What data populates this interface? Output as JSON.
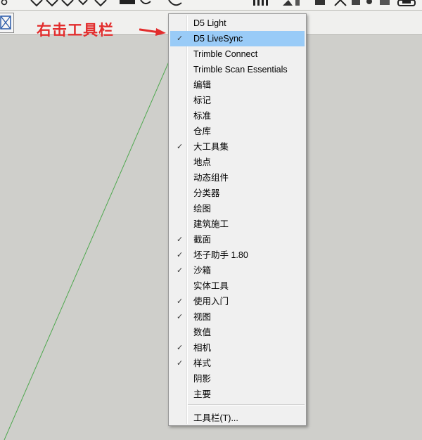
{
  "annotation": {
    "text": "右击工具栏",
    "color": "#e22d2d"
  },
  "context_menu": {
    "items": [
      {
        "label": "D5 Light",
        "checked": false,
        "highlighted": false
      },
      {
        "label": "D5 LiveSync",
        "checked": true,
        "highlighted": true
      },
      {
        "label": "Trimble Connect",
        "checked": false,
        "highlighted": false
      },
      {
        "label": "Trimble Scan Essentials",
        "checked": false,
        "highlighted": false
      },
      {
        "label": "编辑",
        "checked": false,
        "highlighted": false
      },
      {
        "label": "标记",
        "checked": false,
        "highlighted": false
      },
      {
        "label": "标准",
        "checked": false,
        "highlighted": false
      },
      {
        "label": "仓库",
        "checked": false,
        "highlighted": false
      },
      {
        "label": "大工具集",
        "checked": true,
        "highlighted": false
      },
      {
        "label": "地点",
        "checked": false,
        "highlighted": false
      },
      {
        "label": "动态组件",
        "checked": false,
        "highlighted": false
      },
      {
        "label": "分类器",
        "checked": false,
        "highlighted": false
      },
      {
        "label": "绘图",
        "checked": false,
        "highlighted": false
      },
      {
        "label": "建筑施工",
        "checked": false,
        "highlighted": false
      },
      {
        "label": "截面",
        "checked": true,
        "highlighted": false
      },
      {
        "label": "坯子助手 1.80",
        "checked": true,
        "highlighted": false
      },
      {
        "label": "沙箱",
        "checked": true,
        "highlighted": false
      },
      {
        "label": "实体工具",
        "checked": false,
        "highlighted": false
      },
      {
        "label": "使用入门",
        "checked": true,
        "highlighted": false
      },
      {
        "label": "视图",
        "checked": true,
        "highlighted": false
      },
      {
        "label": "数值",
        "checked": false,
        "highlighted": false
      },
      {
        "label": "相机",
        "checked": true,
        "highlighted": false
      },
      {
        "label": "样式",
        "checked": true,
        "highlighted": false
      },
      {
        "label": "阴影",
        "checked": false,
        "highlighted": false
      },
      {
        "label": "主要",
        "checked": false,
        "highlighted": false
      }
    ],
    "footer_item": {
      "label": "工具栏(T)..."
    },
    "check_glyph": "✓",
    "highlight_color": "#99cbf7"
  },
  "toolbar_icons": [
    "search-icon",
    "eraser-icon",
    "tape-icon",
    "paint-icon",
    "push-pull-icon",
    "orbit-icon",
    "section-icon",
    "chart-icon",
    "arrow-icon",
    "save-icon",
    "camera-icon",
    "cube-icon",
    "scene-icon"
  ]
}
